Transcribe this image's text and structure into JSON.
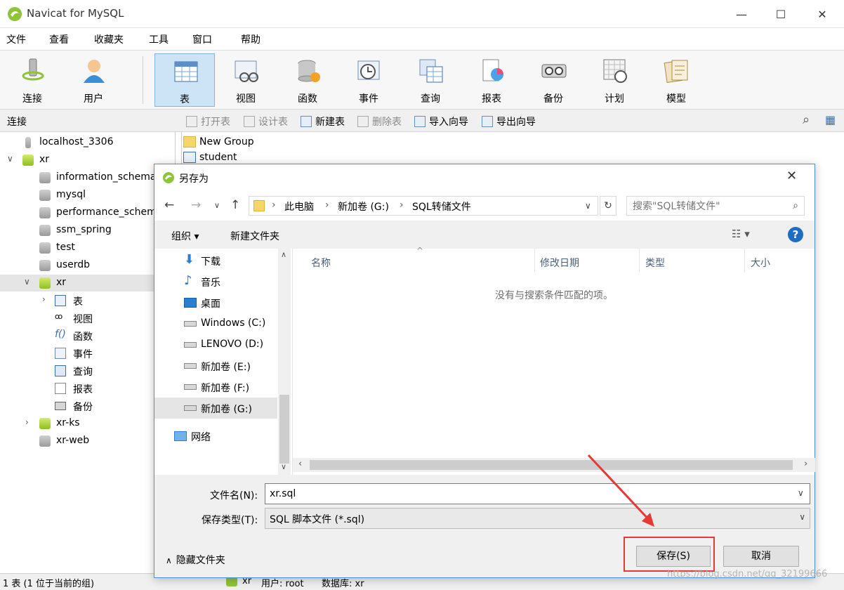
{
  "window": {
    "title": "Navicat for MySQL",
    "minimize": "—",
    "maximize": "☐",
    "close": "✕"
  },
  "menu": [
    "文件",
    "查看",
    "收藏夹",
    "工具",
    "窗口",
    "帮助"
  ],
  "toolbar": [
    {
      "label": "连接",
      "icon": "connection-icon"
    },
    {
      "label": "用户",
      "icon": "user-icon"
    },
    {
      "label": "表",
      "icon": "table-icon",
      "active": true
    },
    {
      "label": "视图",
      "icon": "view-icon"
    },
    {
      "label": "函数",
      "icon": "function-icon"
    },
    {
      "label": "事件",
      "icon": "event-icon"
    },
    {
      "label": "查询",
      "icon": "query-icon"
    },
    {
      "label": "报表",
      "icon": "report-icon"
    },
    {
      "label": "备份",
      "icon": "backup-icon"
    },
    {
      "label": "计划",
      "icon": "schedule-icon"
    },
    {
      "label": "模型",
      "icon": "model-icon"
    }
  ],
  "subbar": {
    "connection_label": "连接",
    "buttons": [
      "打开表",
      "设计表",
      "新建表",
      "删除表",
      "导入向导",
      "导出向导"
    ]
  },
  "tree": [
    {
      "label": "localhost_3306"
    },
    {
      "label": "xr"
    },
    {
      "label": "information_schema"
    },
    {
      "label": "mysql"
    },
    {
      "label": "performance_schema"
    },
    {
      "label": "ssm_spring"
    },
    {
      "label": "test"
    },
    {
      "label": "userdb"
    },
    {
      "label": "xr"
    },
    {
      "label": "表"
    },
    {
      "label": "视图"
    },
    {
      "label": "函数"
    },
    {
      "label": "事件"
    },
    {
      "label": "查询"
    },
    {
      "label": "报表"
    },
    {
      "label": "备份"
    },
    {
      "label": "xr-ks"
    },
    {
      "label": "xr-web"
    }
  ],
  "objects": [
    "New Group",
    "student"
  ],
  "status": {
    "left": "1 表 (1 位于当前的组)",
    "conn": "xr",
    "user": "用户: root",
    "db": "数据库: xr"
  },
  "dialog": {
    "title": "另存为",
    "close": "✕",
    "breadcrumb": [
      "此电脑",
      "新加卷 (G:)",
      "SQL转储文件"
    ],
    "search_placeholder": "搜索\"SQL转储文件\"",
    "organize": "组织 ▾",
    "new_folder": "新建文件夹",
    "nav_items": [
      {
        "label": "下载",
        "icon": "download-icon"
      },
      {
        "label": "音乐",
        "icon": "music-icon"
      },
      {
        "label": "桌面",
        "icon": "desktop-icon"
      },
      {
        "label": "Windows (C:)",
        "icon": "drive-icon"
      },
      {
        "label": "LENOVO (D:)",
        "icon": "drive-icon"
      },
      {
        "label": "新加卷 (E:)",
        "icon": "drive-icon"
      },
      {
        "label": "新加卷 (F:)",
        "icon": "drive-icon"
      },
      {
        "label": "新加卷 (G:)",
        "icon": "drive-icon",
        "selected": true
      },
      {
        "label": "网络",
        "icon": "network-icon"
      }
    ],
    "columns": [
      "名称",
      "修改日期",
      "类型",
      "大小"
    ],
    "empty_message": "没有与搜索条件匹配的项。",
    "filename_label": "文件名(N):",
    "filename_value": "xr.sql",
    "filetype_label": "保存类型(T):",
    "filetype_value": "SQL 脚本文件 (*.sql)",
    "hide_folders": "隐藏文件夹",
    "save": "保存(S)",
    "cancel": "取消"
  },
  "watermark": "https://blog.csdn.net/qq_32199666",
  "colors": {
    "accent": "#1f6cc6",
    "highlight": "#e53935",
    "active_toolbar": "#cde4f7"
  }
}
